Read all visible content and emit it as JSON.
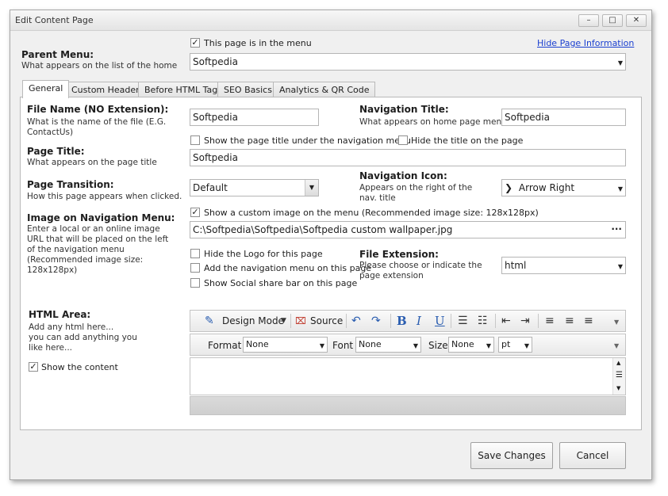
{
  "window": {
    "title": "Edit Content Page",
    "minimize": "–",
    "maximize": "□",
    "close": "✕"
  },
  "parent_menu": {
    "label": "Parent Menu:",
    "description": "What appears on the list of the home",
    "in_menu_label": "This page is in the menu",
    "in_menu_checked": true,
    "hide_info_link": "Hide Page Information",
    "value": "Softpedia"
  },
  "tabs": [
    {
      "label": "General",
      "active": true
    },
    {
      "label": "Custom Header"
    },
    {
      "label": "Before HTML Tag"
    },
    {
      "label": "SEO Basics"
    },
    {
      "label": "Analytics & QR Code"
    }
  ],
  "file_name": {
    "label": "File Name (NO Extension):",
    "description": "What is the name of the file (E.G. ContactUs)",
    "value": "Softpedia"
  },
  "navigation_title": {
    "label": "Navigation Title:",
    "description": "What appears on home page menu",
    "value": "Softpedia"
  },
  "title_options": {
    "show_under_nav": "Show the page title under the navigation menu",
    "hide_title": "Hide the title on the page"
  },
  "page_title": {
    "label": "Page Title:",
    "description": "What appears on the page title",
    "value": "Softpedia"
  },
  "page_transition": {
    "label": "Page Transition:",
    "description": "How this page appears when clicked.",
    "value": "Default"
  },
  "navigation_icon": {
    "label": "Navigation Icon:",
    "description": "Appears on the right of the nav. title",
    "value": "Arrow Right",
    "glyph": "❯"
  },
  "nav_image": {
    "label": "Image on Navigation Menu:",
    "description": "Enter a local or an online image URL that will be placed on the left of the navigation menu (Recommended image size: 128x128px)",
    "show_custom_label": "Show a custom image on the menu (Recommended image size: 128x128px)",
    "show_custom_checked": true,
    "value": "C:\\Softpedia\\Softpedia\\Softpedia custom wallpaper.jpg",
    "browse": "···"
  },
  "options": {
    "hide_logo": "Hide the Logo for this page",
    "add_nav_menu": "Add the navigation menu on this page",
    "show_social": "Show Social share bar on this page"
  },
  "file_extension": {
    "label": "File Extension:",
    "description": "Please choose or indicate the page extension",
    "value": "html"
  },
  "html_area": {
    "label": "HTML Area:",
    "description": "Add any html here...\nyou can add anything you like here...",
    "show_content_label": "Show the content",
    "show_content_checked": true
  },
  "editor_toolbar": {
    "design_mode": "Design Mode",
    "source": "Source",
    "bold": "B",
    "italic": "I",
    "underline": "U",
    "format_label": "Format",
    "format_value": "None",
    "font_label": "Font",
    "font_value": "None",
    "size_label": "Size",
    "size_value": "None",
    "unit_value": "pt"
  },
  "buttons": {
    "save": "Save Changes",
    "cancel": "Cancel"
  },
  "colors": {
    "link": "#1a3fd0",
    "window_bg": "#f0f0f0"
  }
}
